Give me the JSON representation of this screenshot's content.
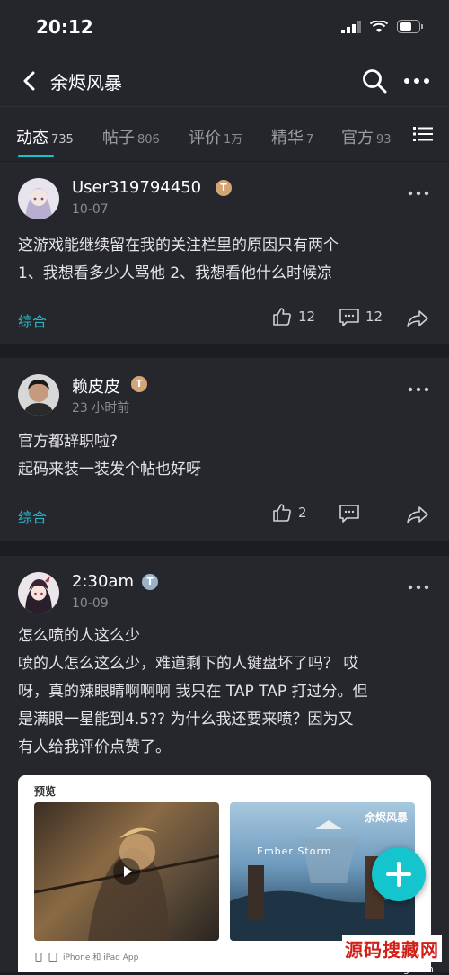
{
  "status_bar": {
    "time": "20:12"
  },
  "header": {
    "title": "余烬风暴"
  },
  "tabs": [
    {
      "label": "动态",
      "count": "735"
    },
    {
      "label": "帖子",
      "count": "806"
    },
    {
      "label": "评价",
      "count": "1万"
    },
    {
      "label": "精华",
      "count": "7"
    },
    {
      "label": "官方",
      "count": "93"
    }
  ],
  "posts": [
    {
      "username": "User319794450",
      "badge": "T",
      "date": "10-07",
      "body_lines": [
        "这游戏能继续留在我的关注栏里的原因只有两个",
        "1、我想看多少人骂他 2、我想看他什么时候凉"
      ],
      "tag": "综合",
      "likes": "12",
      "comments": "12"
    },
    {
      "username": "赖皮皮",
      "badge": "T",
      "date": "23 小时前",
      "body_lines": [
        "官方都辞职啦?",
        "起码来装一装发个帖也好呀"
      ],
      "tag": "综合",
      "likes": "2",
      "comments": ""
    },
    {
      "username": "2:30am",
      "badge": "T",
      "date": "10-09",
      "body_lines": [
        "怎么喷的人这么少",
        "喷的人怎么这么少，难道剩下的人键盘坏了吗？ 哎",
        "呀，真的辣眼睛啊啊啊 我只在 TAP TAP 打过分。但",
        "是满眼一星能到4.5?? 为什么我还要来喷？因为又",
        "有人给我评价点赞了。"
      ],
      "preview": {
        "label": "预览",
        "logo": "余烬风暴",
        "banner": "Ember Storm",
        "devices": "iPhone 和 iPad App"
      }
    }
  ],
  "watermark": {
    "main": "源码搜藏网",
    "sub": "codesocang.com"
  },
  "colors": {
    "accent": "#15c5ce",
    "background": "#1c1d22",
    "card": "#26272c",
    "tag": "#28b5c6"
  },
  "icons": [
    "back-arrow-icon",
    "search-icon",
    "more-icon",
    "menu-icon",
    "like-icon",
    "comment-icon",
    "share-icon",
    "play-icon",
    "plus-icon"
  ]
}
